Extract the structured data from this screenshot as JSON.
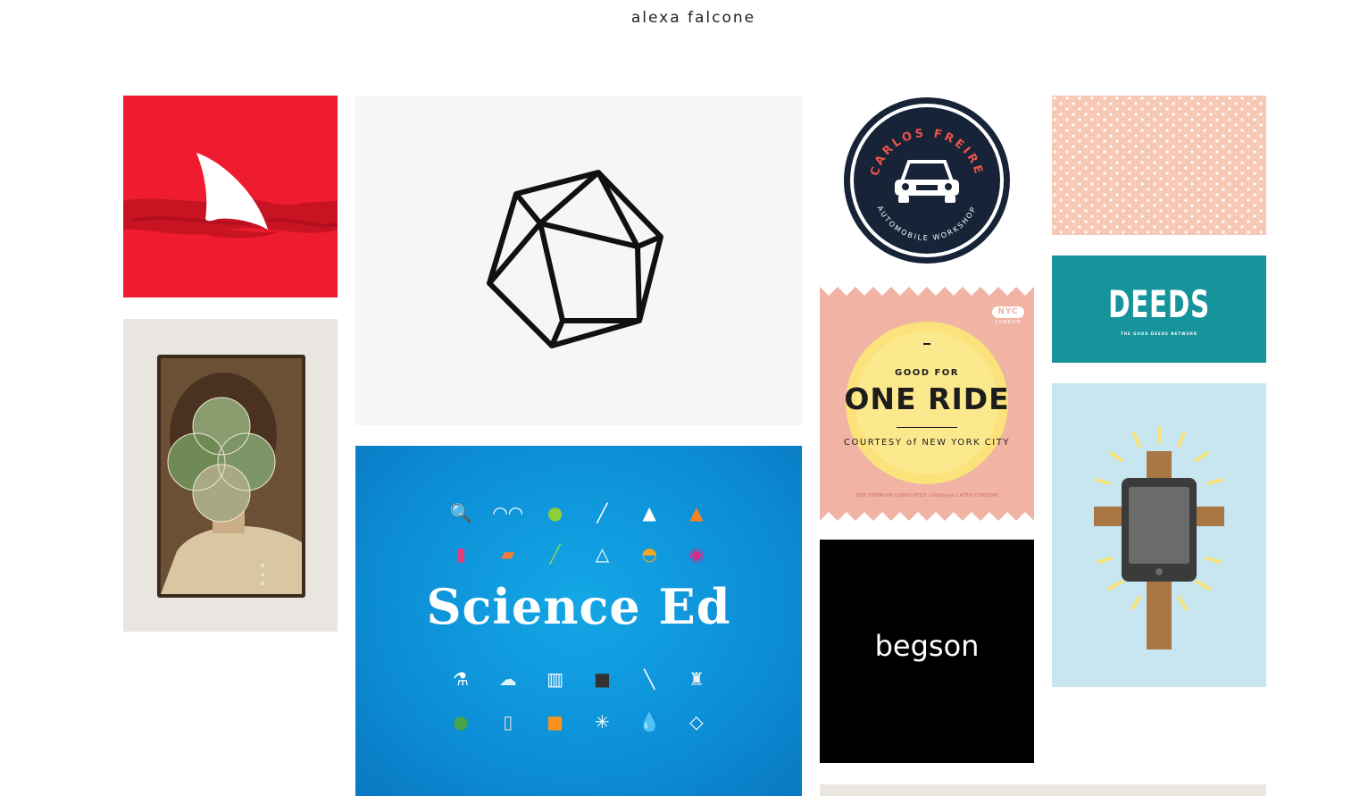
{
  "site": {
    "title": "alexa falcone"
  },
  "tiles": {
    "shark": {
      "label": "shark fin"
    },
    "collage": {
      "label": "portrait collage"
    },
    "polyhedron": {
      "label": "polyhedron"
    },
    "science": {
      "title": "Science Ed"
    },
    "carlos": {
      "top_text": "CARLOS FREIRE",
      "bottom_text": "AUTOMOBILE WORKSHOP"
    },
    "ride": {
      "badge": "NYC",
      "badge_sub": "CONDOM",
      "top": "GOOD FOR",
      "title": "ONE RIDE",
      "subtitle": "COURTESY of NEW YORK CITY",
      "fine": "ONE PREMIUM LUBRICATED LifeStyles LATEX CONDOM"
    },
    "begson": {
      "wordmark": "begson"
    },
    "deeds": {
      "wordmark": "DEEDS",
      "tagline": "THE GOOD DEEDS NETWORK"
    }
  },
  "colors": {
    "shark_bg": "#ee1c2e",
    "science_bg": "#0c8ed6",
    "carlos_navy": "#172337",
    "carlos_red": "#e8534a",
    "ride_pink": "#f0b3a4",
    "ride_yellow": "#fbe27a",
    "deeds_teal": "#16939b",
    "cross_bg": "#c7e6ef"
  }
}
